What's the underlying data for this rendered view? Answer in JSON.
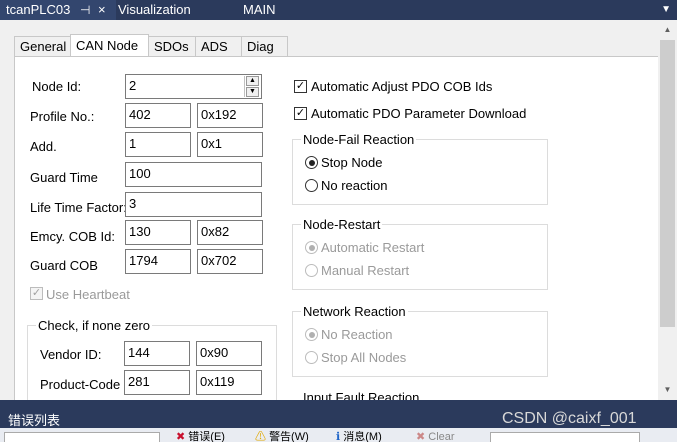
{
  "doc_tabs": {
    "tab1": "tcanPLC03",
    "tab1_pin": "⊣",
    "tab1_close": "×",
    "tab2": "Visualization",
    "tab3": "MAIN",
    "menu_arrow": "▼"
  },
  "inner_tabs": [
    "General",
    "CAN Node",
    "SDOs",
    "ADS",
    "Diag"
  ],
  "form": {
    "node_id": {
      "label": "Node Id:",
      "value": "2"
    },
    "profile_no": {
      "label": "Profile No.:",
      "value": "402",
      "hex": "0x192"
    },
    "add": {
      "label": "Add.",
      "value": "1",
      "hex": "0x1"
    },
    "guard_time": {
      "label": "Guard Time",
      "value": "100"
    },
    "life_time_factor": {
      "label": "Life Time Factor:",
      "value": "3"
    },
    "emcy_cob_id": {
      "label": "Emcy. COB Id:",
      "value": "130",
      "hex": "0x82"
    },
    "guard_cob": {
      "label": "Guard COB",
      "value": "1794",
      "hex": "0x702"
    },
    "use_heartbeat": {
      "label": "Use Heartbeat",
      "checked": true,
      "disabled": true
    }
  },
  "check_group": {
    "title": "Check, if none zero",
    "vendor_id": {
      "label": "Vendor ID:",
      "value": "144",
      "hex": "0x90"
    },
    "product_code": {
      "label": "Product-Code",
      "value": "281",
      "hex": "0x119"
    }
  },
  "right": {
    "auto_adjust_pdo": {
      "label": "Automatic Adjust PDO COB Ids",
      "checked": true
    },
    "auto_pdo_download": {
      "label": "Automatic PDO Parameter Download",
      "checked": true
    },
    "node_fail": {
      "title": "Node-Fail Reaction",
      "options": [
        "Stop Node",
        "No reaction"
      ],
      "selected": 0
    },
    "node_restart": {
      "title": "Node-Restart",
      "options": [
        "Automatic Restart",
        "Manual Restart"
      ],
      "selected": 0,
      "disabled": true
    },
    "network_reaction": {
      "title": "Network Reaction",
      "options": [
        "No Reaction",
        "Stop All Nodes"
      ],
      "selected": 0,
      "disabled": true
    },
    "input_fault_partial": "Input Fault Reaction"
  },
  "error_list": {
    "title": "错误列表",
    "errors_label": "错误(E)",
    "warnings_label": "警告(W)",
    "messages_label": "消息(M)",
    "clear_label": "Clear"
  },
  "watermark": "CSDN @caixf_001",
  "colors": {
    "title_bar": "#2b3a5c",
    "panel_bg": "#f0f0f0",
    "scroll_thumb": "#cdcdcd"
  }
}
